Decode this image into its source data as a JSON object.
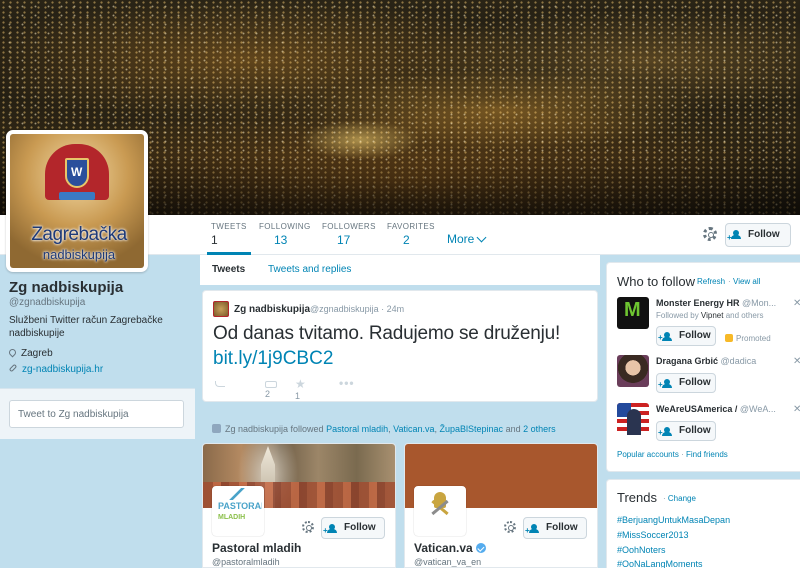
{
  "profile": {
    "name": "Zg nadbiskupija",
    "handle": "@zgnadbiskupija",
    "bio": "Službeni Twitter račun Zagrebačke nadbiskupije",
    "location": "Zagreb",
    "url": "zg-nadbiskupija.hr",
    "avatar_line1": "Zagrebačka",
    "avatar_line2": "nadbiskupija",
    "tweet_to_placeholder": "Tweet to Zg nadbiskupija"
  },
  "nav": {
    "stats": [
      {
        "label": "TWEETS",
        "value": "1"
      },
      {
        "label": "FOLLOWING",
        "value": "13"
      },
      {
        "label": "FOLLOWERS",
        "value": "17"
      },
      {
        "label": "FAVORITES",
        "value": "2"
      }
    ],
    "more_label": "More",
    "follow_label": "Follow"
  },
  "timeline_tabs": {
    "tweets": "Tweets",
    "replies": "Tweets and replies"
  },
  "tweet": {
    "name": "Zg nadbiskupija",
    "handle": "@zgnadbiskupija · 24m",
    "text": "Od danas tvitamo. Radujemo se druženju!",
    "link": "bit.ly/1j9CBC2",
    "retweets": "2",
    "favorites": "1"
  },
  "activity": {
    "prefix": "Zg nadbiskupija followed",
    "u1": "Pastoral mladih",
    "u2": "Vatican.va",
    "u3": "ŽupaBlStepinac",
    "and": "and",
    "others": "2 others"
  },
  "cards": [
    {
      "name": "Pastoral mladih",
      "handle": "@pastoralmladih",
      "follow": "Follow",
      "logo_top": "PASTORAL",
      "logo_bottom": "MLADIH"
    },
    {
      "name": "Vatican.va",
      "handle": "@vatican_va_en",
      "follow": "Follow"
    }
  ],
  "who_to_follow": {
    "title": "Who to follow",
    "refresh": "Refresh",
    "view_all": "View all",
    "suggestions": [
      {
        "name": "Monster Energy HR",
        "handle": "@Mon...",
        "context_prefix": "Followed by",
        "context_user": "Vipnet",
        "context_suffix": "and others",
        "follow": "Follow",
        "promoted": "Promoted"
      },
      {
        "name": "Dragana Grbić",
        "handle": "@dadica",
        "follow": "Follow"
      },
      {
        "name": "WeAreUSAmerica /",
        "handle": "@WeA...",
        "follow": "Follow"
      }
    ],
    "popular": "Popular accounts",
    "find": "Find friends"
  },
  "trends": {
    "title": "Trends",
    "change": "Change",
    "items": [
      "#BerjuangUntukMasaDepan",
      "#MissSoccer2013",
      "#OohNoters",
      "#OoNaLangMoments"
    ]
  },
  "colors": {
    "accent": "#0084b4",
    "background": "#c0deed"
  }
}
